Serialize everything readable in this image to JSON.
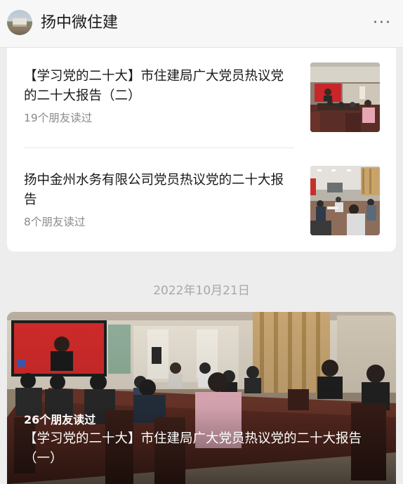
{
  "header": {
    "title": "扬中微住建",
    "more_label": "···"
  },
  "articles": [
    {
      "title": "【学习党的二十大】市住建局广大党员热议党的二十大报告（二）",
      "reads": "19个朋友读过"
    },
    {
      "title": "扬中金州水务有限公司党员热议党的二十大报告",
      "reads": "8个朋友读过"
    }
  ],
  "date_separator": "2022年10月21日",
  "featured": {
    "reads": "26个朋友读过",
    "title": "【学习党的二十大】市住建局广大党员热议党的二十大报告（一）"
  },
  "colors": {
    "background": "#ededed",
    "card": "#ffffff",
    "secondary_text": "#8a8a8a",
    "date_text": "#a8a8a8"
  }
}
